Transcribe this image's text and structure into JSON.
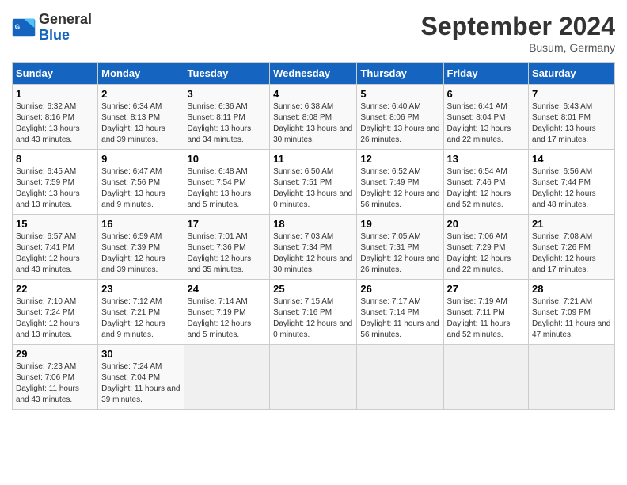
{
  "header": {
    "logo_general": "General",
    "logo_blue": "Blue",
    "month_title": "September 2024",
    "location": "Busum, Germany"
  },
  "weekdays": [
    "Sunday",
    "Monday",
    "Tuesday",
    "Wednesday",
    "Thursday",
    "Friday",
    "Saturday"
  ],
  "weeks": [
    [
      {
        "day": "1",
        "sunrise": "6:32 AM",
        "sunset": "8:16 PM",
        "daylight": "13 hours and 43 minutes."
      },
      {
        "day": "2",
        "sunrise": "6:34 AM",
        "sunset": "8:13 PM",
        "daylight": "13 hours and 39 minutes."
      },
      {
        "day": "3",
        "sunrise": "6:36 AM",
        "sunset": "8:11 PM",
        "daylight": "13 hours and 34 minutes."
      },
      {
        "day": "4",
        "sunrise": "6:38 AM",
        "sunset": "8:08 PM",
        "daylight": "13 hours and 30 minutes."
      },
      {
        "day": "5",
        "sunrise": "6:40 AM",
        "sunset": "8:06 PM",
        "daylight": "13 hours and 26 minutes."
      },
      {
        "day": "6",
        "sunrise": "6:41 AM",
        "sunset": "8:04 PM",
        "daylight": "13 hours and 22 minutes."
      },
      {
        "day": "7",
        "sunrise": "6:43 AM",
        "sunset": "8:01 PM",
        "daylight": "13 hours and 17 minutes."
      }
    ],
    [
      {
        "day": "8",
        "sunrise": "6:45 AM",
        "sunset": "7:59 PM",
        "daylight": "13 hours and 13 minutes."
      },
      {
        "day": "9",
        "sunrise": "6:47 AM",
        "sunset": "7:56 PM",
        "daylight": "13 hours and 9 minutes."
      },
      {
        "day": "10",
        "sunrise": "6:48 AM",
        "sunset": "7:54 PM",
        "daylight": "13 hours and 5 minutes."
      },
      {
        "day": "11",
        "sunrise": "6:50 AM",
        "sunset": "7:51 PM",
        "daylight": "13 hours and 0 minutes."
      },
      {
        "day": "12",
        "sunrise": "6:52 AM",
        "sunset": "7:49 PM",
        "daylight": "12 hours and 56 minutes."
      },
      {
        "day": "13",
        "sunrise": "6:54 AM",
        "sunset": "7:46 PM",
        "daylight": "12 hours and 52 minutes."
      },
      {
        "day": "14",
        "sunrise": "6:56 AM",
        "sunset": "7:44 PM",
        "daylight": "12 hours and 48 minutes."
      }
    ],
    [
      {
        "day": "15",
        "sunrise": "6:57 AM",
        "sunset": "7:41 PM",
        "daylight": "12 hours and 43 minutes."
      },
      {
        "day": "16",
        "sunrise": "6:59 AM",
        "sunset": "7:39 PM",
        "daylight": "12 hours and 39 minutes."
      },
      {
        "day": "17",
        "sunrise": "7:01 AM",
        "sunset": "7:36 PM",
        "daylight": "12 hours and 35 minutes."
      },
      {
        "day": "18",
        "sunrise": "7:03 AM",
        "sunset": "7:34 PM",
        "daylight": "12 hours and 30 minutes."
      },
      {
        "day": "19",
        "sunrise": "7:05 AM",
        "sunset": "7:31 PM",
        "daylight": "12 hours and 26 minutes."
      },
      {
        "day": "20",
        "sunrise": "7:06 AM",
        "sunset": "7:29 PM",
        "daylight": "12 hours and 22 minutes."
      },
      {
        "day": "21",
        "sunrise": "7:08 AM",
        "sunset": "7:26 PM",
        "daylight": "12 hours and 17 minutes."
      }
    ],
    [
      {
        "day": "22",
        "sunrise": "7:10 AM",
        "sunset": "7:24 PM",
        "daylight": "12 hours and 13 minutes."
      },
      {
        "day": "23",
        "sunrise": "7:12 AM",
        "sunset": "7:21 PM",
        "daylight": "12 hours and 9 minutes."
      },
      {
        "day": "24",
        "sunrise": "7:14 AM",
        "sunset": "7:19 PM",
        "daylight": "12 hours and 5 minutes."
      },
      {
        "day": "25",
        "sunrise": "7:15 AM",
        "sunset": "7:16 PM",
        "daylight": "12 hours and 0 minutes."
      },
      {
        "day": "26",
        "sunrise": "7:17 AM",
        "sunset": "7:14 PM",
        "daylight": "11 hours and 56 minutes."
      },
      {
        "day": "27",
        "sunrise": "7:19 AM",
        "sunset": "7:11 PM",
        "daylight": "11 hours and 52 minutes."
      },
      {
        "day": "28",
        "sunrise": "7:21 AM",
        "sunset": "7:09 PM",
        "daylight": "11 hours and 47 minutes."
      }
    ],
    [
      {
        "day": "29",
        "sunrise": "7:23 AM",
        "sunset": "7:06 PM",
        "daylight": "11 hours and 43 minutes."
      },
      {
        "day": "30",
        "sunrise": "7:24 AM",
        "sunset": "7:04 PM",
        "daylight": "11 hours and 39 minutes."
      },
      null,
      null,
      null,
      null,
      null
    ]
  ]
}
